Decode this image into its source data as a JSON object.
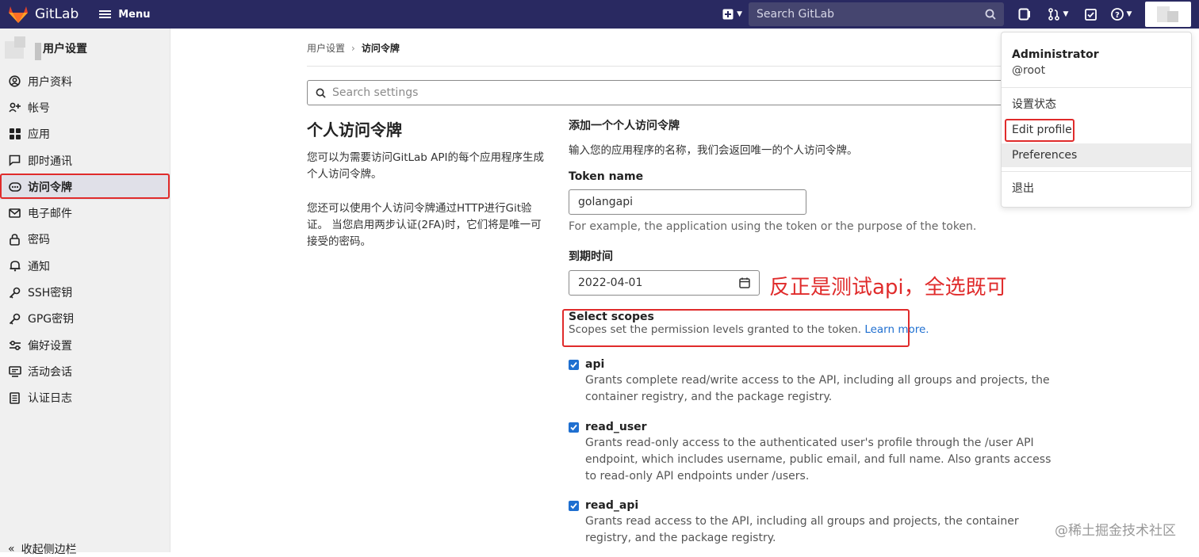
{
  "navbar": {
    "brand": "GitLab",
    "menu_label": "Menu",
    "search_placeholder": "Search GitLab"
  },
  "sidebar": {
    "title": "用户设置",
    "items": [
      {
        "label": "用户资料",
        "icon": "user-icon"
      },
      {
        "label": "帐号",
        "icon": "account-icon"
      },
      {
        "label": "应用",
        "icon": "applications-icon"
      },
      {
        "label": "即时通讯",
        "icon": "chat-icon"
      },
      {
        "label": "访问令牌",
        "icon": "token-icon",
        "active": true
      },
      {
        "label": "电子邮件",
        "icon": "mail-icon"
      },
      {
        "label": "密码",
        "icon": "lock-icon"
      },
      {
        "label": "通知",
        "icon": "bell-icon"
      },
      {
        "label": "SSH密钥",
        "icon": "key-icon"
      },
      {
        "label": "GPG密钥",
        "icon": "gpg-key-icon"
      },
      {
        "label": "偏好设置",
        "icon": "preferences-icon"
      },
      {
        "label": "活动会话",
        "icon": "monitor-icon"
      },
      {
        "label": "认证日志",
        "icon": "log-icon"
      }
    ],
    "collapse_label": "收起侧边栏"
  },
  "breadcrumb": {
    "parent": "用户设置",
    "current": "访问令牌"
  },
  "settings_search_placeholder": "Search settings",
  "left": {
    "title": "个人访问令牌",
    "para1": "您可以为需要访问GitLab API的每个应用程序生成个人访问令牌。",
    "para2": "您还可以使用个人访问令牌通过HTTP进行Git验证。 当您启用两步认证(2FA)时，它们将是唯一可接受的密码。"
  },
  "form": {
    "heading": "添加一个个人访问令牌",
    "subheading": "输入您的应用程序的名称，我们会返回唯一的个人访问令牌。",
    "token_name_label": "Token name",
    "token_name_value": "golangapi",
    "token_name_help": "For example, the application using the token or the purpose of the token.",
    "expiry_label": "到期时间",
    "expiry_value": "2022-04-01",
    "scopes_title": "Select scopes",
    "scopes_desc": "Scopes set the permission levels granted to the token.",
    "scopes_link": "Learn more.",
    "scopes": [
      {
        "name": "api",
        "checked": true,
        "desc": "Grants complete read/write access to the API, including all groups and projects, the container registry, and the package registry."
      },
      {
        "name": "read_user",
        "checked": true,
        "desc": "Grants read-only access to the authenticated user's profile through the /user API endpoint, which includes username, public email, and full name. Also grants access to read-only API endpoints under /users."
      },
      {
        "name": "read_api",
        "checked": true,
        "desc": "Grants read access to the API, including all groups and projects, the container registry, and the package registry."
      }
    ]
  },
  "annotation": "反正是测试api，全选既可",
  "dropdown": {
    "name": "Administrator",
    "username": "@root",
    "items": [
      "设置状态",
      "Edit profile",
      "Preferences",
      "退出"
    ]
  },
  "watermark": "@稀土掘金技术社区",
  "colors": {
    "navbar": "#292961",
    "annotation_red": "#e02b2b",
    "link_blue": "#1f6fd0"
  }
}
